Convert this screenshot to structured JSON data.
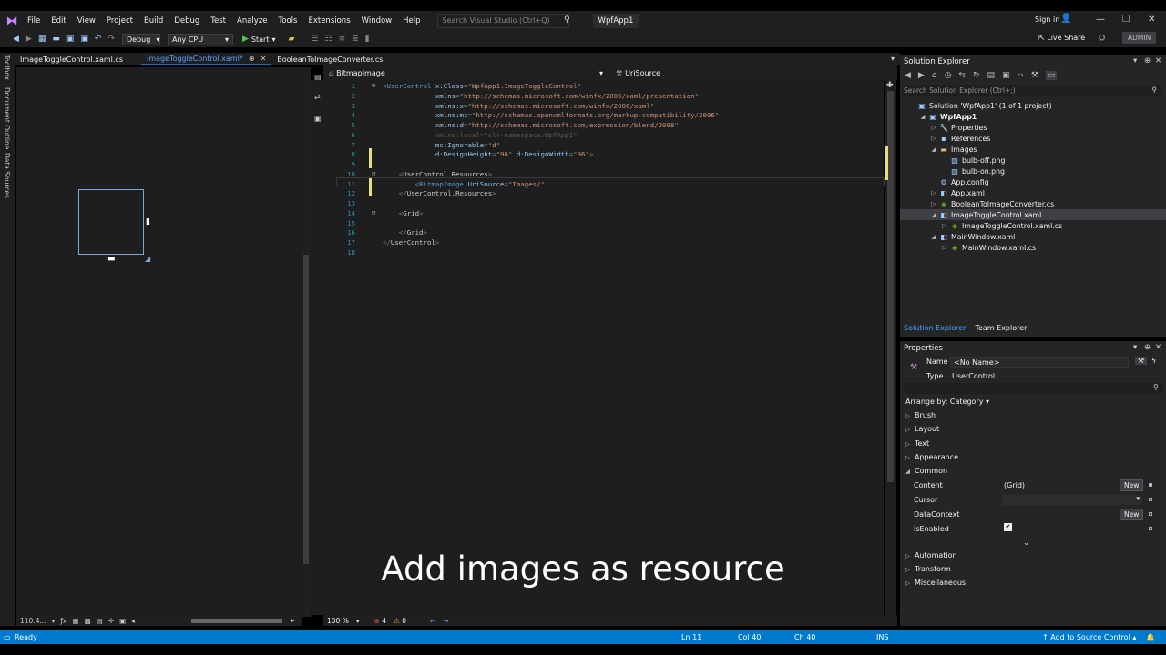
{
  "titlebar": {
    "menus": [
      "File",
      "Edit",
      "View",
      "Project",
      "Build",
      "Debug",
      "Test",
      "Analyze",
      "Tools",
      "Extensions",
      "Window",
      "Help"
    ],
    "search_placeholder": "Search Visual Studio (Ctrl+Q)",
    "project": "WpfApp1",
    "signin": "Sign in"
  },
  "toolbar": {
    "config": "Debug",
    "platform": "Any CPU",
    "start": "Start",
    "liveshare": "Live Share",
    "admin": "ADMIN"
  },
  "left_rail": {
    "tabs": [
      "Toolbox",
      "Document Outline",
      "Data Sources"
    ]
  },
  "doc_tabs": [
    {
      "label": "ImageToggleControl.xaml.cs",
      "active": false
    },
    {
      "label": "ImageToggleControl.xaml*",
      "active": true
    },
    {
      "label": "BooleanToImageConverter.cs",
      "active": false
    }
  ],
  "navbar": {
    "left": "BitmapImage",
    "right": "UriSource"
  },
  "code_lines": [
    {
      "n": "1",
      "parts": [
        [
          "t-gray",
          "<"
        ],
        [
          "t-tag",
          "UserControl"
        ],
        [
          "t-att",
          " x:Class"
        ],
        [
          "t-gray",
          "=\""
        ],
        [
          "t-str",
          "WpfApp1.ImageToggleControl"
        ],
        [
          "t-gray",
          "\""
        ]
      ]
    },
    {
      "n": "2",
      "parts": [
        [
          "t-att",
          "             xmlns"
        ],
        [
          "t-gray",
          "=\""
        ],
        [
          "t-str",
          "http://schemas.microsoft.com/winfx/2006/xaml/presentation"
        ],
        [
          "t-gray",
          "\""
        ]
      ]
    },
    {
      "n": "3",
      "parts": [
        [
          "t-att",
          "             xmlns:x"
        ],
        [
          "t-gray",
          "=\""
        ],
        [
          "t-str",
          "http://schemas.microsoft.com/winfx/2006/xaml"
        ],
        [
          "t-gray",
          "\""
        ]
      ]
    },
    {
      "n": "4",
      "parts": [
        [
          "t-att",
          "             xmlns:mc"
        ],
        [
          "t-gray",
          "=\""
        ],
        [
          "t-str",
          "http://schemas.openxmlformats.org/markup-compatibility/2006"
        ],
        [
          "t-gray",
          "\""
        ]
      ]
    },
    {
      "n": "5",
      "parts": [
        [
          "t-att",
          "             xmlns:d"
        ],
        [
          "t-gray",
          "=\""
        ],
        [
          "t-str",
          "http://schemas.microsoft.com/expression/blend/2008"
        ],
        [
          "t-gray",
          "\""
        ]
      ]
    },
    {
      "n": "6",
      "parts": [
        [
          "t-dim",
          "             xmlns:local=\"clr-namespace:WpfApp1\""
        ]
      ]
    },
    {
      "n": "7",
      "parts": [
        [
          "t-att",
          "             mc:Ignorable"
        ],
        [
          "t-gray",
          "=\""
        ],
        [
          "t-str",
          "d"
        ],
        [
          "t-gray",
          "\""
        ]
      ]
    },
    {
      "n": "8",
      "parts": [
        [
          "t-att",
          "             d:DesignHeight"
        ],
        [
          "t-gray",
          "=\""
        ],
        [
          "t-str",
          "96"
        ],
        [
          "t-gray",
          "\""
        ],
        [
          "t-att",
          " d:DesignWidth"
        ],
        [
          "t-gray",
          "=\""
        ],
        [
          "t-str",
          "96"
        ],
        [
          "t-gray",
          "\">"
        ]
      ]
    },
    {
      "n": "9",
      "parts": []
    },
    {
      "n": "10",
      "parts": [
        [
          "t-gray",
          "    <"
        ],
        [
          "t-elem",
          "UserControl.Resources"
        ],
        [
          "t-gray",
          ">"
        ]
      ]
    },
    {
      "n": "11",
      "parts": [
        [
          "t-gray",
          "        <"
        ],
        [
          "t-tag",
          "BitmapImage"
        ],
        [
          "t-att",
          " UriSource"
        ],
        [
          "t-gray",
          "=\""
        ],
        [
          "t-str",
          "Images/"
        ],
        [
          "t-gray",
          "\""
        ]
      ]
    },
    {
      "n": "12",
      "parts": [
        [
          "t-gray",
          "    </"
        ],
        [
          "t-elem",
          "UserControl.Resources"
        ],
        [
          "t-gray",
          ">"
        ]
      ]
    },
    {
      "n": "13",
      "parts": []
    },
    {
      "n": "14",
      "parts": [
        [
          "t-gray",
          "    <"
        ],
        [
          "t-elem",
          "Grid"
        ],
        [
          "t-gray",
          ">"
        ]
      ]
    },
    {
      "n": "15",
      "parts": []
    },
    {
      "n": "16",
      "parts": [
        [
          "t-gray",
          "    </"
        ],
        [
          "t-elem",
          "Grid"
        ],
        [
          "t-gray",
          ">"
        ]
      ]
    },
    {
      "n": "17",
      "parts": [
        [
          "t-gray",
          "</"
        ],
        [
          "t-elem",
          "UserControl"
        ],
        [
          "t-gray",
          ">"
        ]
      ]
    },
    {
      "n": "18",
      "parts": []
    }
  ],
  "designer_bottom": {
    "zoom": "110.4..."
  },
  "editor_bottom": {
    "zoom": "100 %",
    "errors": "4",
    "warnings": "0"
  },
  "solution_explorer": {
    "title": "Solution Explorer",
    "search_placeholder": "Search Solution Explorer (Ctrl+;)",
    "tree": [
      {
        "indent": 0,
        "arrow": "",
        "icon": "solution-icon",
        "glyph": "▣",
        "label": "Solution 'WpfApp1' (1 of 1 project)",
        "sel": false,
        "bold": false
      },
      {
        "indent": 1,
        "arrow": "◢",
        "icon": "project-icon",
        "glyph": "▣",
        "label": "WpfApp1",
        "sel": false,
        "bold": true
      },
      {
        "indent": 2,
        "arrow": "▷",
        "icon": "wrench-icon",
        "glyph": "🔧",
        "label": "Properties",
        "sel": false,
        "bold": false
      },
      {
        "indent": 2,
        "arrow": "▷",
        "icon": "references-icon",
        "glyph": "▪",
        "label": "References",
        "sel": false,
        "bold": false
      },
      {
        "indent": 2,
        "arrow": "◢",
        "icon": "folder-icon",
        "glyph": "▬",
        "label": "Images",
        "sel": false,
        "bold": false
      },
      {
        "indent": 3,
        "arrow": "",
        "icon": "image-file-icon",
        "glyph": "▧",
        "label": "bulb-off.png",
        "sel": false,
        "bold": false
      },
      {
        "indent": 3,
        "arrow": "",
        "icon": "image-file-icon",
        "glyph": "▧",
        "label": "bulb-on.png",
        "sel": false,
        "bold": false
      },
      {
        "indent": 2,
        "arrow": "",
        "icon": "config-file-icon",
        "glyph": "⚙",
        "label": "App.config",
        "sel": false,
        "bold": false
      },
      {
        "indent": 2,
        "arrow": "▷",
        "icon": "xaml-file-icon",
        "glyph": "◧",
        "label": "App.xaml",
        "sel": false,
        "bold": false
      },
      {
        "indent": 2,
        "arrow": "▷",
        "icon": "cs-file-icon",
        "glyph": "◈",
        "label": "BooleanToImageConverter.cs",
        "sel": false,
        "bold": false
      },
      {
        "indent": 2,
        "arrow": "◢",
        "icon": "xaml-file-icon",
        "glyph": "◧",
        "label": "ImageToggleControl.xaml",
        "sel": true,
        "bold": false
      },
      {
        "indent": 3,
        "arrow": "▷",
        "icon": "cs-file-icon",
        "glyph": "◈",
        "label": "ImageToggleControl.xaml.cs",
        "sel": false,
        "bold": false
      },
      {
        "indent": 2,
        "arrow": "◢",
        "icon": "xaml-file-icon",
        "glyph": "◧",
        "label": "MainWindow.xaml",
        "sel": false,
        "bold": false
      },
      {
        "indent": 3,
        "arrow": "▷",
        "icon": "cs-file-icon",
        "glyph": "◈",
        "label": "MainWindow.xaml.cs",
        "sel": false,
        "bold": false
      }
    ],
    "tabs": [
      "Solution Explorer",
      "Team Explorer"
    ]
  },
  "properties": {
    "title": "Properties",
    "name_label": "Name",
    "name_value": "<No Name>",
    "type_label": "Type",
    "type_value": "UserControl",
    "arrange": "Arrange by: Category",
    "categories": [
      "Brush",
      "Layout",
      "Text",
      "Appearance",
      "Common",
      "Automation",
      "Transform",
      "Miscellaneous"
    ],
    "common": {
      "content_label": "Content",
      "content_value": "(Grid)",
      "cursor_label": "Cursor",
      "datacontext_label": "DataContext",
      "isenabled_label": "IsEnabled",
      "new_label": "New"
    }
  },
  "statusbar": {
    "ready": "Ready",
    "ln": "Ln 11",
    "col": "Col 40",
    "ch": "Ch 40",
    "ins": "INS",
    "source_control": "Add to Source Control"
  },
  "caption": "Add images as resource"
}
